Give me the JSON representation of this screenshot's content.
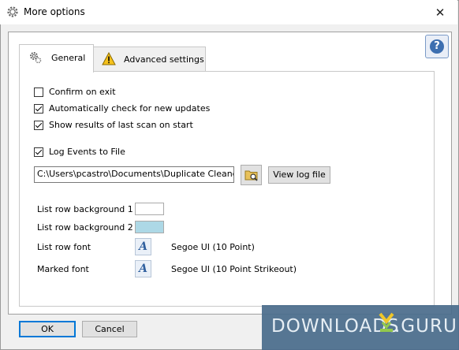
{
  "window": {
    "title": "More options",
    "close_glyph": "✕"
  },
  "help_button": {
    "glyph": "?"
  },
  "tabs": [
    {
      "label": "General",
      "icon": "gear-icon",
      "active": true
    },
    {
      "label": "Advanced settings",
      "icon": "warning-icon",
      "active": false
    }
  ],
  "options": {
    "confirm_exit": {
      "label": "Confirm on exit",
      "checked": false
    },
    "auto_update": {
      "label": "Automatically check for new updates",
      "checked": true
    },
    "show_last_scan": {
      "label": "Show results of last scan on start",
      "checked": true
    },
    "log_events": {
      "label": "Log Events to File",
      "checked": true
    }
  },
  "log": {
    "path_value": "C:\\Users\\pcastro\\Documents\\Duplicate Cleaner lo",
    "view_label": "View log file"
  },
  "appearance": {
    "row_bg1_label": "List row background 1",
    "row_bg1_color": "#ffffff",
    "row_bg2_label": "List row background 2",
    "row_bg2_color": "#add8e6",
    "row_font_label": "List row font",
    "row_font_value": "Segoe UI (10 Point)",
    "marked_font_label": "Marked font",
    "marked_font_value": "Segoe UI (10 Point Strikeout)",
    "font_glyph": "A"
  },
  "buttons": {
    "ok": "OK",
    "cancel": "Cancel"
  },
  "watermark": {
    "text_left": "DOWNLOADS",
    "text_right": ".GURU"
  }
}
